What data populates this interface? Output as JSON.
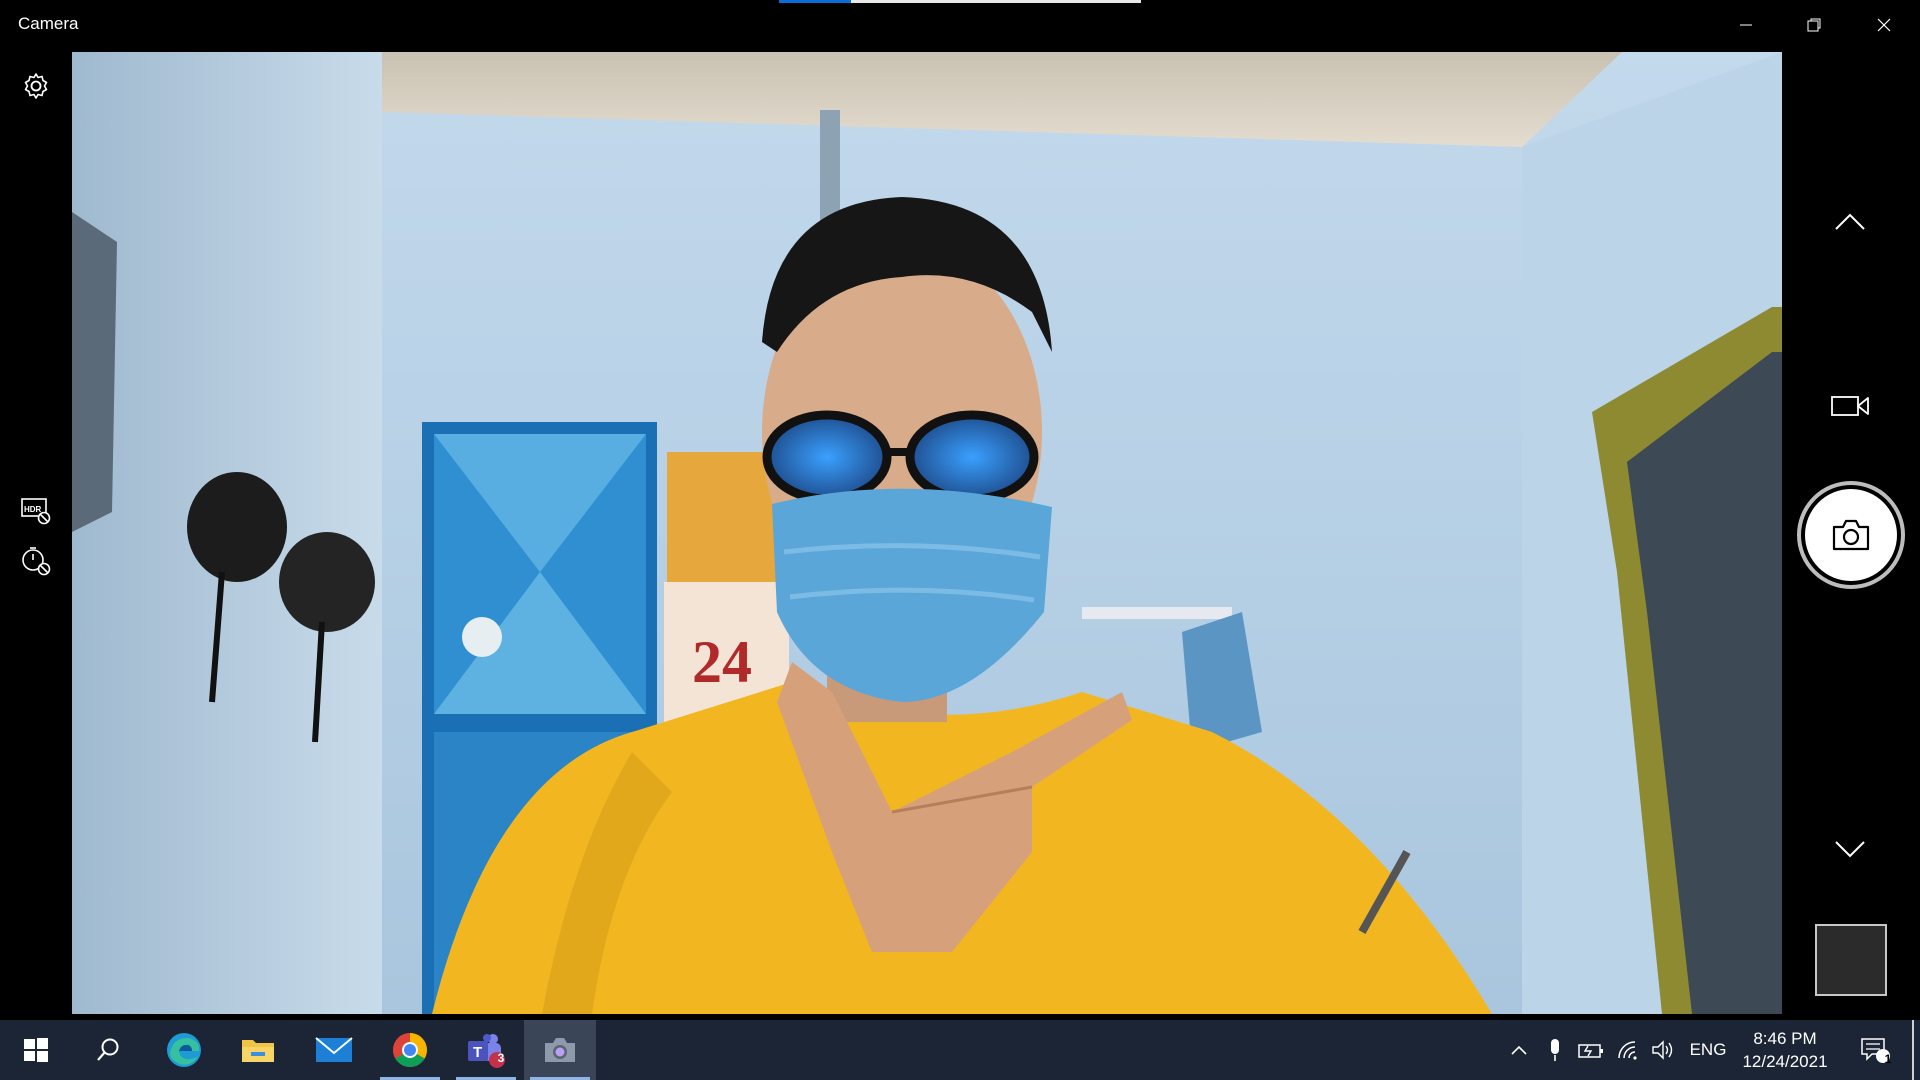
{
  "window": {
    "title": "Camera",
    "load_progress": 0.2
  },
  "left_rail": {
    "icons": [
      "gear-icon",
      "hdr-off-icon",
      "timer-off-icon"
    ]
  },
  "right_rail": {
    "icons": [
      "chevron-up-icon",
      "video-mode-icon",
      "camera-shutter-icon",
      "chevron-down-icon",
      "last-photo-thumbnail"
    ]
  },
  "taskbar": {
    "apps": [
      {
        "name": "start",
        "icon": "windows-start-icon"
      },
      {
        "name": "search",
        "icon": "search-icon"
      },
      {
        "name": "edge",
        "icon": "edge-icon"
      },
      {
        "name": "file-explorer",
        "icon": "folder-icon"
      },
      {
        "name": "mail",
        "icon": "mail-icon"
      },
      {
        "name": "chrome",
        "icon": "chrome-icon",
        "running": true
      },
      {
        "name": "teams",
        "icon": "teams-icon",
        "running": true,
        "badge": "3"
      },
      {
        "name": "camera",
        "icon": "camera-app-icon",
        "running": true,
        "selected": true
      }
    ],
    "tray": {
      "language": "ENG",
      "time": "8:46 PM",
      "date": "12/24/2021",
      "notification_count": "1"
    }
  },
  "colors": {
    "accent": "#0a6cd6",
    "taskbar": "#1b2535",
    "shirt": "#f2b720",
    "wall": "#b9d3e8"
  }
}
